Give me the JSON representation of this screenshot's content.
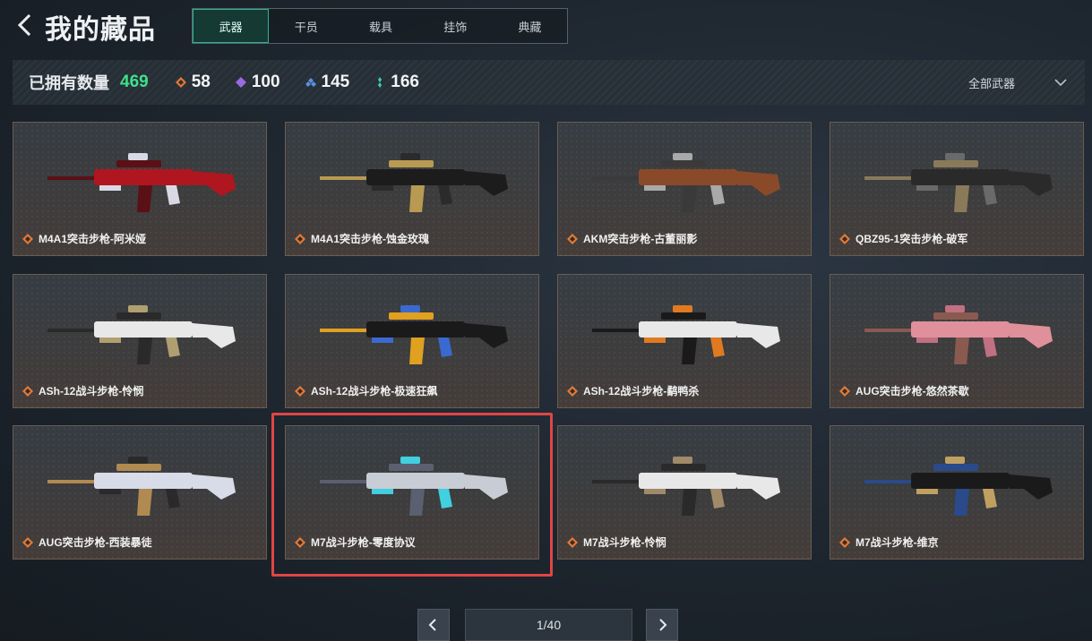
{
  "header": {
    "title": "我的藏品"
  },
  "tabs": [
    {
      "label": "武器",
      "active": true
    },
    {
      "label": "干员",
      "active": false
    },
    {
      "label": "载具",
      "active": false
    },
    {
      "label": "挂饰",
      "active": false
    },
    {
      "label": "典藏",
      "active": false
    }
  ],
  "stats": {
    "owned_label": "已拥有数量",
    "owned_count": "469",
    "rarities": [
      {
        "icon": "orange-diamond-icon",
        "color": "#e07a3a",
        "count": "58"
      },
      {
        "icon": "purple-diamond-icon",
        "color": "#9a6ae0",
        "count": "100"
      },
      {
        "icon": "blue-diamond-icon",
        "color": "#5a8fe0",
        "count": "145"
      },
      {
        "icon": "teal-diamond-icon",
        "color": "#3fd0b0",
        "count": "166"
      }
    ],
    "filter_label": "全部武器"
  },
  "items": [
    {
      "name": "M4A1突击步枪-阿米娅",
      "rarity_color": "#e07a3a",
      "palette": [
        "#b0161f",
        "#5a1015",
        "#d9d9e6"
      ]
    },
    {
      "name": "M4A1突击步枪-蚀金玫瑰",
      "rarity_color": "#e07a3a",
      "palette": [
        "#1c1c1c",
        "#b89a52",
        "#2b2b2b"
      ]
    },
    {
      "name": "AKM突击步枪-古董丽影",
      "rarity_color": "#e07a3a",
      "palette": [
        "#8a4a2a",
        "#3a3a3a",
        "#a9a9a9"
      ]
    },
    {
      "name": "QBZ95-1突击步枪-破军",
      "rarity_color": "#e07a3a",
      "palette": [
        "#2a2a2a",
        "#8a7a5a",
        "#6a6a6a"
      ]
    },
    {
      "name": "ASh-12战斗步枪-怜悯",
      "rarity_color": "#e07a3a",
      "palette": [
        "#e8e8e8",
        "#2a2a2a",
        "#b0a070"
      ]
    },
    {
      "name": "ASh-12战斗步枪-极速狂飙",
      "rarity_color": "#e07a3a",
      "palette": [
        "#1a1a1a",
        "#e0a020",
        "#3a6ad0"
      ]
    },
    {
      "name": "ASh-12战斗步枪-鹬鸭杀",
      "rarity_color": "#e07a3a",
      "palette": [
        "#e8e8e8",
        "#1a1a1a",
        "#e07a20"
      ]
    },
    {
      "name": "AUG突击步枪-悠然茶歇",
      "rarity_color": "#e07a3a",
      "palette": [
        "#e0909a",
        "#8a5a50",
        "#c07080"
      ]
    },
    {
      "name": "AUG突击步枪-西装暴徒",
      "rarity_color": "#e07a3a",
      "palette": [
        "#d8dbe8",
        "#b08a50",
        "#2a2a2a"
      ]
    },
    {
      "name": "M7战斗步枪-零度协议",
      "rarity_color": "#e07a3a",
      "palette": [
        "#c8ccd4",
        "#5a6070",
        "#40d0e0"
      ]
    },
    {
      "name": "M7战斗步枪-怜悯",
      "rarity_color": "#e07a3a",
      "palette": [
        "#e8e8e8",
        "#2a2a2a",
        "#a08a6a"
      ]
    },
    {
      "name": "M7战斗步枪-维京",
      "rarity_color": "#e07a3a",
      "palette": [
        "#1a1a1a",
        "#2a4a8a",
        "#c0a060"
      ]
    }
  ],
  "pagination": {
    "page_label": "1/40"
  }
}
